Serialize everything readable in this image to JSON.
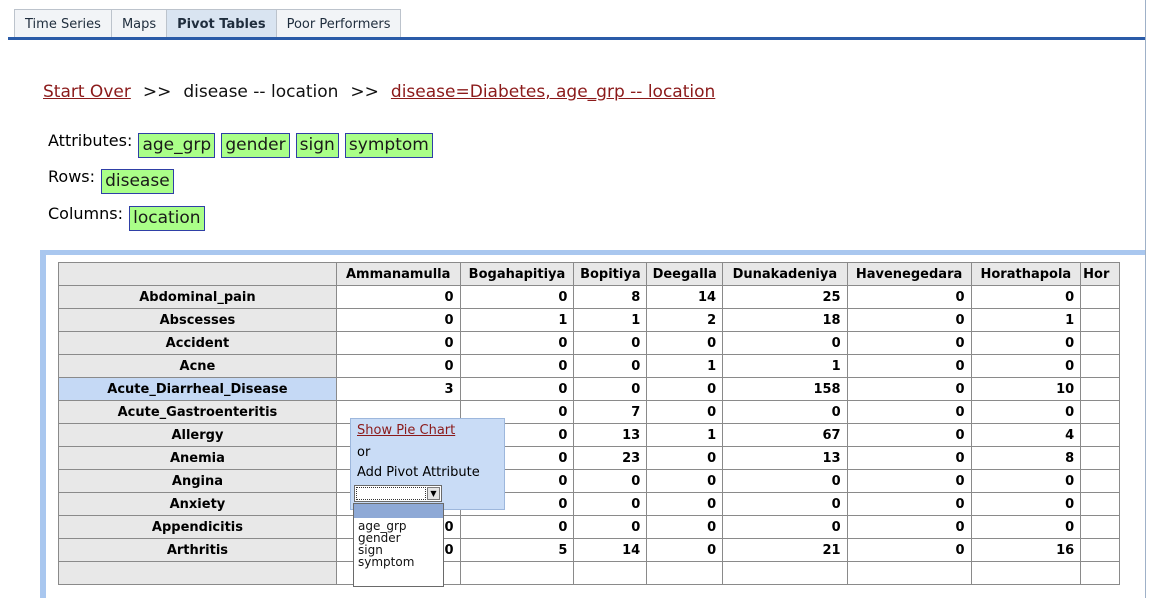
{
  "tabs": [
    "Time Series",
    "Maps",
    "Pivot Tables",
    "Poor Performers"
  ],
  "active_tab": "Pivot Tables",
  "breadcrumb": {
    "start_over": "Start Over",
    "sep": ">>",
    "step1": "disease -- location",
    "step2": "disease=Diabetes, age_grp -- location"
  },
  "attributes": {
    "label": "Attributes:",
    "items": [
      "age_grp",
      "gender",
      "sign",
      "symptom"
    ]
  },
  "rows": {
    "label": "Rows:",
    "items": [
      "disease"
    ]
  },
  "columns": {
    "label": "Columns:",
    "items": [
      "location"
    ]
  },
  "colors": {
    "chip_bg": "#aaff88",
    "link": "#8b1a1a",
    "accent": "#2a5ba8",
    "selected_row": "#c5d9f5"
  },
  "table": {
    "col_headers": [
      "Ammanamulla",
      "Bogahapitiya",
      "Bopitiya",
      "Deegalla",
      "Dunakadeniya",
      "Havenegedara",
      "Horathapola",
      "Hor"
    ],
    "rows": [
      {
        "label": "Abdominal_pain",
        "values": [
          "0",
          "0",
          "8",
          "14",
          "25",
          "0",
          "0"
        ]
      },
      {
        "label": "Abscesses",
        "values": [
          "0",
          "1",
          "1",
          "2",
          "18",
          "0",
          "1"
        ]
      },
      {
        "label": "Accident",
        "values": [
          "0",
          "0",
          "0",
          "0",
          "0",
          "0",
          "0"
        ]
      },
      {
        "label": "Acne",
        "values": [
          "0",
          "0",
          "0",
          "1",
          "1",
          "0",
          "0"
        ]
      },
      {
        "label": "Acute_Diarrheal_Disease",
        "values": [
          "3",
          "0",
          "0",
          "0",
          "158",
          "0",
          "10"
        ]
      },
      {
        "label": "Acute_Gastroenteritis",
        "values": [
          "",
          "0",
          "7",
          "0",
          "0",
          "0",
          "0"
        ]
      },
      {
        "label": "Allergy",
        "values": [
          "",
          "0",
          "13",
          "1",
          "67",
          "0",
          "4"
        ]
      },
      {
        "label": "Anemia",
        "values": [
          "",
          "0",
          "23",
          "0",
          "13",
          "0",
          "8"
        ]
      },
      {
        "label": "Angina",
        "values": [
          "0",
          "0",
          "0",
          "0",
          "0",
          "0",
          "0"
        ]
      },
      {
        "label": "Anxiety",
        "values": [
          "0",
          "0",
          "0",
          "0",
          "0",
          "0",
          "0"
        ]
      },
      {
        "label": "Appendicitis",
        "values": [
          "0",
          "0",
          "0",
          "0",
          "0",
          "0",
          "0"
        ]
      },
      {
        "label": "Arthritis",
        "values": [
          "0",
          "5",
          "14",
          "0",
          "21",
          "0",
          "16"
        ]
      }
    ],
    "selected_row": "Acute_Diarrheal_Disease"
  },
  "popup": {
    "show_pie": "Show Pie Chart",
    "or": "or",
    "add_pivot": "Add Pivot Attribute",
    "options": [
      "age_grp",
      "gender",
      "sign",
      "symptom"
    ]
  }
}
